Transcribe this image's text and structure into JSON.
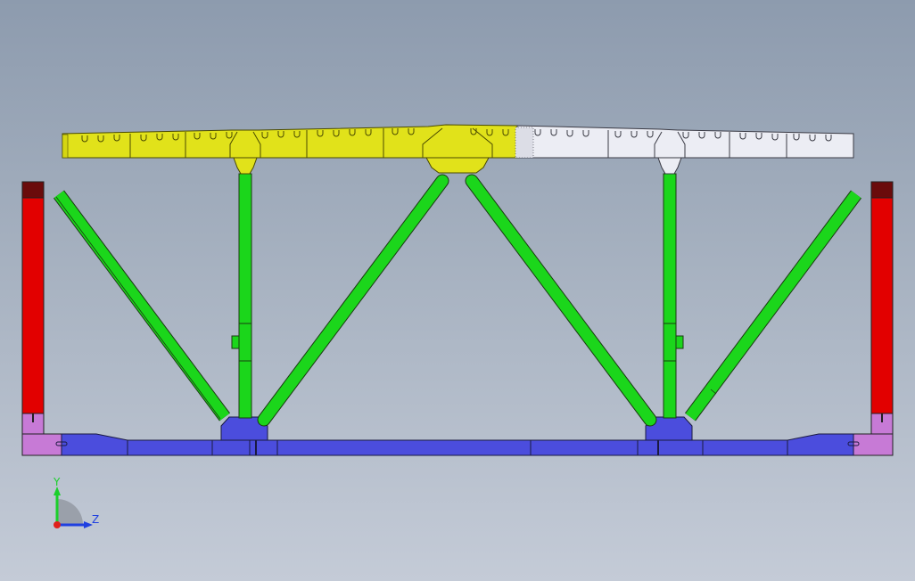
{
  "triad": {
    "y_label": "Y",
    "z_label": "Z"
  },
  "colors": {
    "background_top": "#8d9bae",
    "background_bottom": "#c4cbd7",
    "top_chord_yellow": "#e1e21a",
    "top_chord_white": "#ecedf4",
    "web_members_green": "#1bd61b",
    "bottom_chord_blue": "#4b4ddd",
    "end_post_red": "#e20000",
    "end_base_purple": "#c77ad6",
    "triad_x_red": "#e0201b",
    "triad_y_green": "#1bcf2b",
    "triad_z_blue": "#2040e0"
  }
}
